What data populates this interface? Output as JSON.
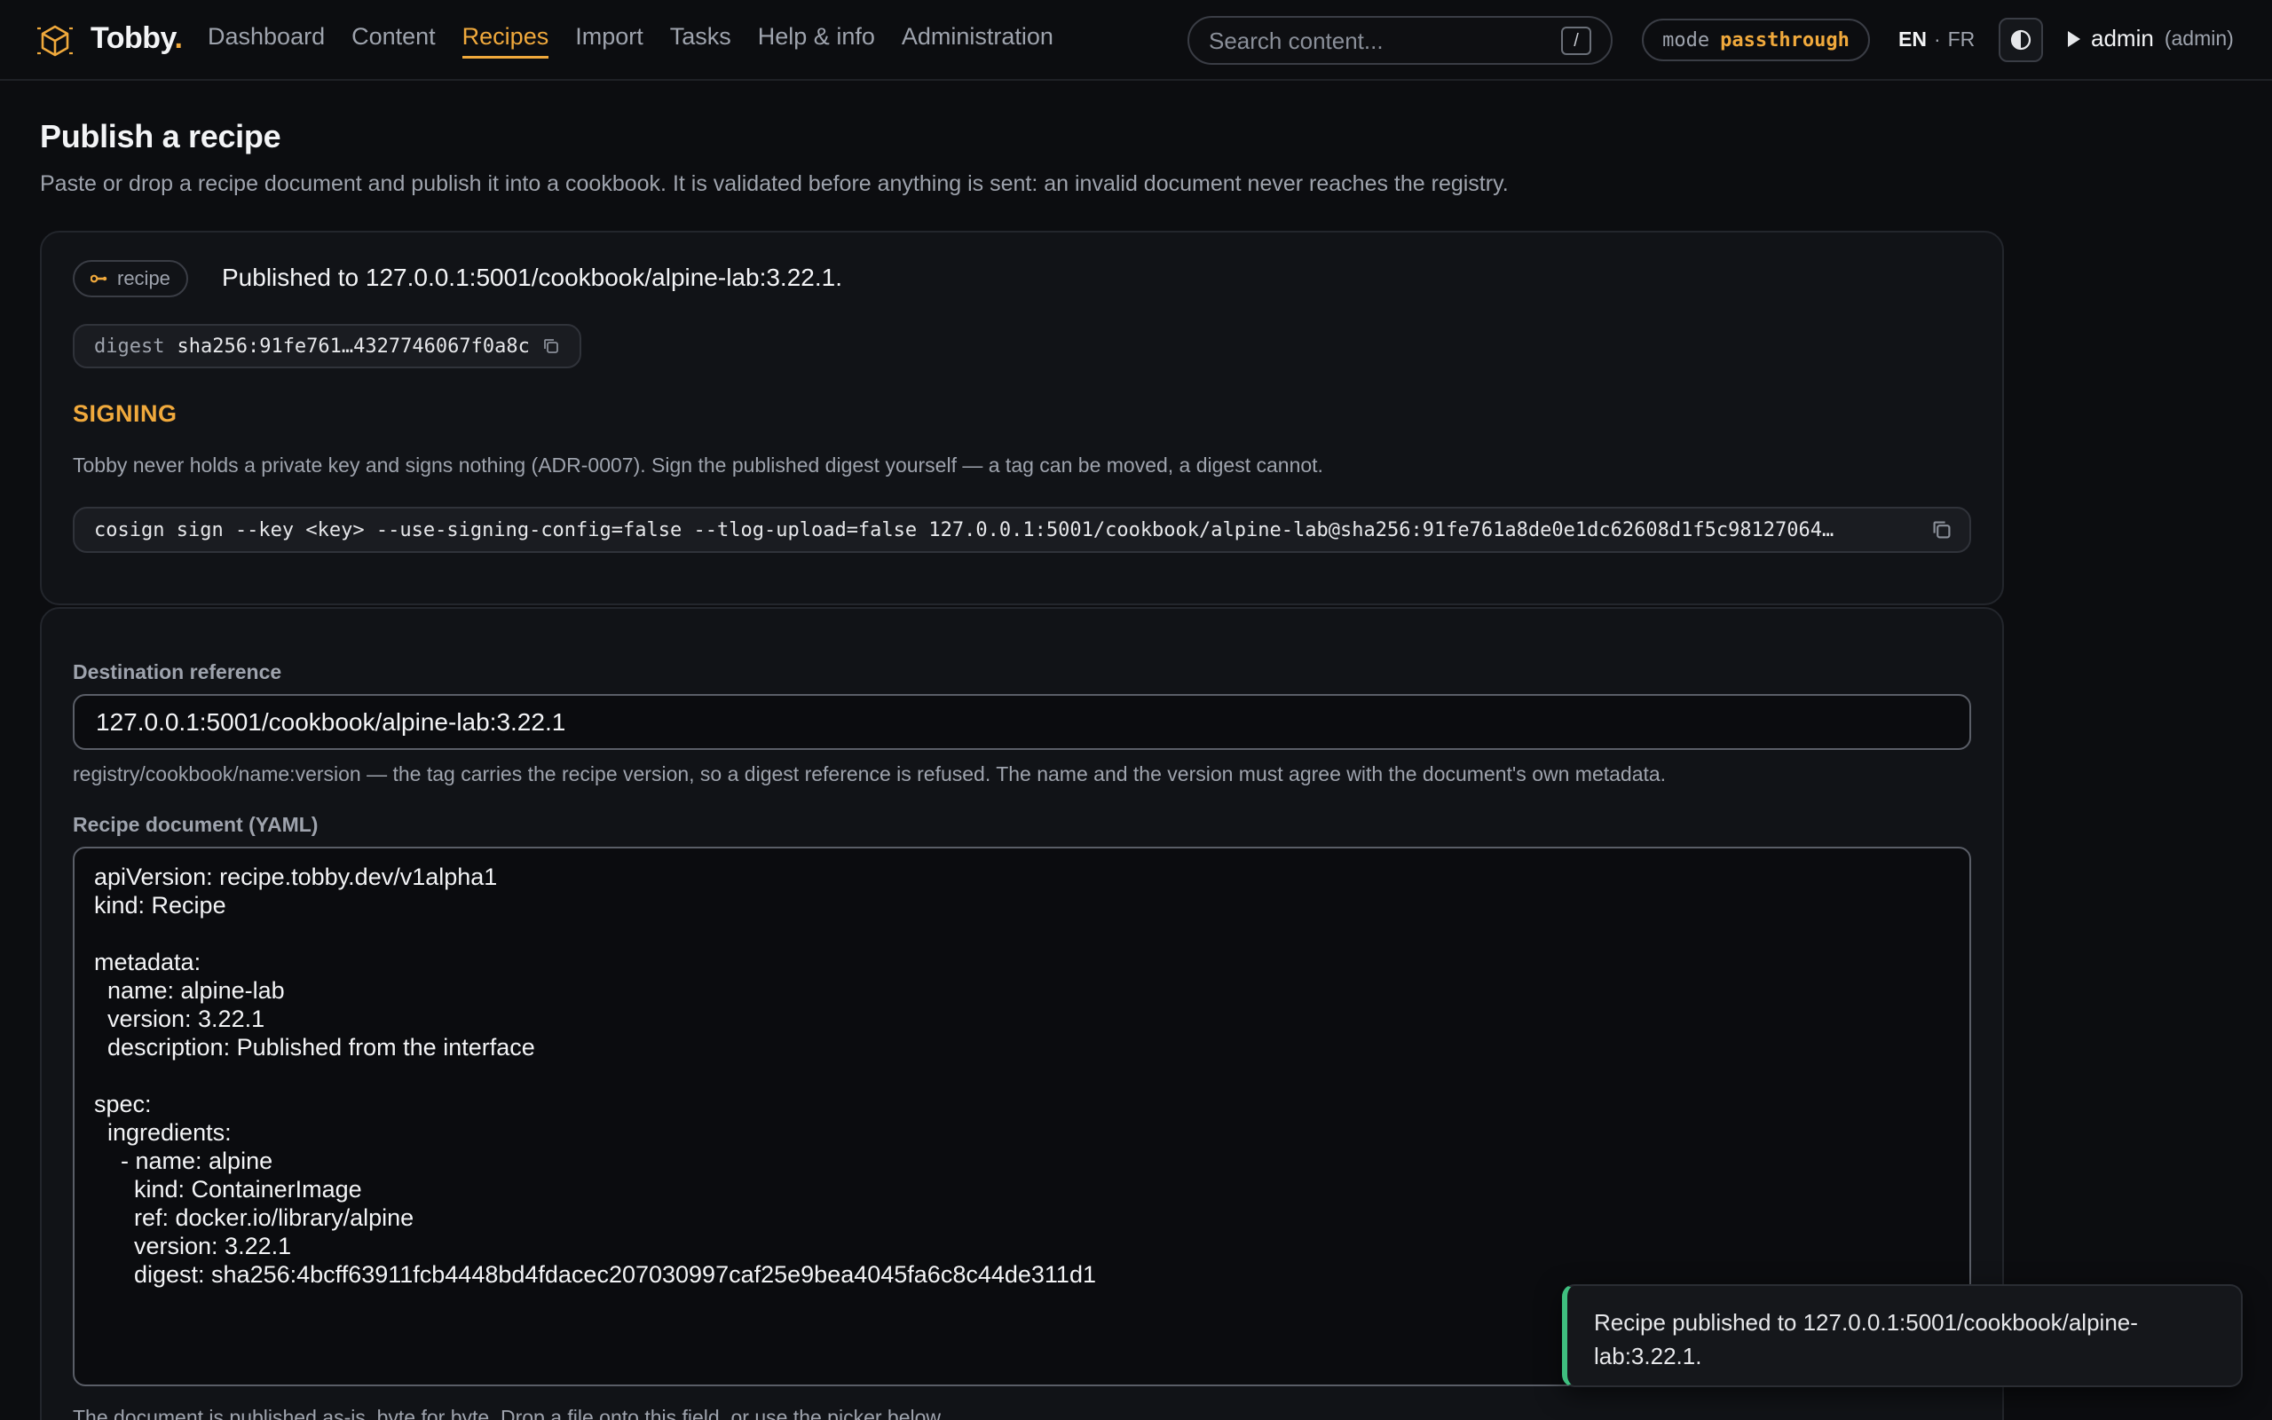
{
  "app": {
    "brand": "Tobby",
    "brand_dot": "."
  },
  "nav": {
    "items": [
      {
        "label": "Dashboard"
      },
      {
        "label": "Content"
      },
      {
        "label": "Recipes",
        "active": true
      },
      {
        "label": "Import"
      },
      {
        "label": "Tasks"
      },
      {
        "label": "Help & info"
      },
      {
        "label": "Administration"
      }
    ]
  },
  "search": {
    "placeholder": "Search content...",
    "shortcut": "/"
  },
  "mode": {
    "key": "mode",
    "value": "passthrough"
  },
  "lang": {
    "active": "EN",
    "separator": "·",
    "other": "FR"
  },
  "user": {
    "name": "admin",
    "role": "(admin)"
  },
  "page": {
    "title": "Publish a recipe",
    "subtitle": "Paste or drop a recipe document and publish it into a cookbook. It is validated before anything is sent: an invalid document never reaches the registry."
  },
  "result": {
    "chip": "recipe",
    "message": "Published to 127.0.0.1:5001/cookbook/alpine-lab:3.22.1.",
    "digest_key": "digest",
    "digest_value": "sha256:91fe761…4327746067f0a8c",
    "signing_heading": "SIGNING",
    "signing_text": "Tobby never holds a private key and signs nothing (ADR-0007). Sign the published digest yourself — a tag can be moved, a digest cannot.",
    "command": "cosign sign --key <key> --use-signing-config=false --tlog-upload=false 127.0.0.1:5001/cookbook/alpine-lab@sha256:91fe761a8de0e1dc62608d1f5c98127064…"
  },
  "form": {
    "dest_label": "Destination reference",
    "dest_value": "127.0.0.1:5001/cookbook/alpine-lab:3.22.1",
    "dest_hint": "registry/cookbook/name:version — the tag carries the recipe version, so a digest reference is refused. The name and the version must agree with the document's own metadata.",
    "doc_label": "Recipe document (YAML)",
    "doc_value": "apiVersion: recipe.tobby.dev/v1alpha1\nkind: Recipe\n\nmetadata:\n  name: alpine-lab\n  version: 3.22.1\n  description: Published from the interface\n\nspec:\n  ingredients:\n    - name: alpine\n      kind: ContainerImage\n      ref: docker.io/library/alpine\n      version: 3.22.1\n      digest: sha256:4bcff63911fcb4448bd4fdacec207030997caf25e9bea4045fa6c8c44de311d1",
    "doc_hint": "The document is published as-is, byte for byte. Drop a file onto this field, or use the picker below."
  },
  "toast": {
    "message": "Recipe published to 127.0.0.1:5001/cookbook/alpine-lab:3.22.1."
  },
  "colors": {
    "accent": "#f0a93c",
    "success": "#3fbf7f",
    "background": "#0c0d10"
  },
  "icons": [
    "cube-logo-icon",
    "link-icon",
    "copy-icon",
    "contrast-icon",
    "caret-right-icon"
  ]
}
